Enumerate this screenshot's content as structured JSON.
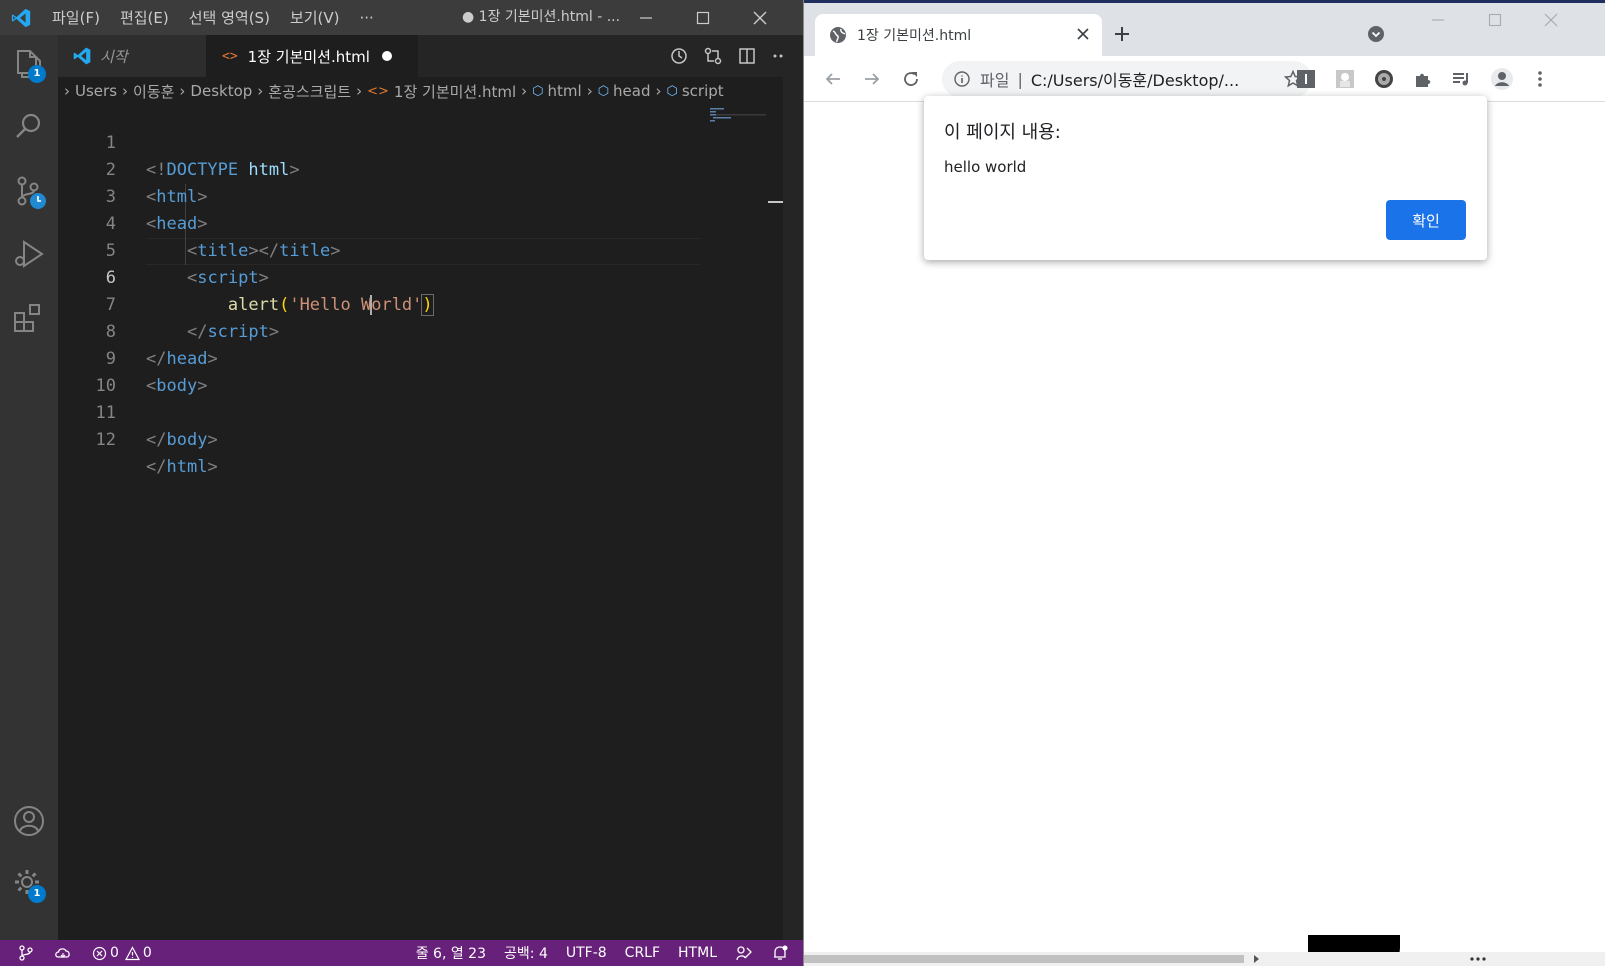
{
  "vscode": {
    "menu": [
      "파일(F)",
      "편집(E)",
      "선택 영역(S)",
      "보기(V)",
      "···"
    ],
    "title": "● 1장 기본미션.html - ...",
    "activity_badges": {
      "explorer": "1",
      "settings": "1"
    },
    "tabs": [
      {
        "label": "시작",
        "active": false
      },
      {
        "label": "1장 기본미션.html",
        "active": true,
        "dirty": true
      }
    ],
    "breadcrumb": [
      "Users",
      "이동훈",
      "Desktop",
      "혼공스크립트",
      "1장 기본미션.html",
      "html",
      "head",
      "script"
    ],
    "line_numbers": [
      "1",
      "2",
      "3",
      "4",
      "5",
      "6",
      "7",
      "8",
      "9",
      "10",
      "11",
      "12"
    ],
    "current_line": 6,
    "code": {
      "l1": {
        "open": "<!",
        "kw": "DOCTYPE",
        "attr": "html",
        "close": ">"
      },
      "l2": {
        "tag": "html"
      },
      "l3": {
        "tag": "head"
      },
      "l4": {
        "tag": "title",
        "close_tag": "title"
      },
      "l5": {
        "tag": "script"
      },
      "l6": {
        "fn": "alert",
        "str_before_cursor": "'Hello W",
        "str_after_cursor": "orld'"
      },
      "l7": {
        "tag": "script"
      },
      "l8": {
        "tag": "head"
      },
      "l9": {
        "tag": "body"
      },
      "l11": {
        "tag": "body"
      },
      "l12": {
        "tag": "html"
      }
    },
    "statusbar": {
      "errors": "0",
      "warnings": "0",
      "position": "줄 6, 열 23",
      "spaces": "공백: 4",
      "encoding": "UTF-8",
      "eol": "CRLF",
      "language": "HTML"
    },
    "colors": {
      "statusbar": "#68217a",
      "titlebar": "#3c3c3c",
      "editor_bg": "#1e1e1e"
    }
  },
  "chrome": {
    "tab_title": "1장 기본미션.html",
    "omnibox_prefix": "파일",
    "url": "C:/Users/이동훈/Desktop/...",
    "dialog": {
      "title": "이 페이지 내용:",
      "message": "hello world",
      "ok_label": "확인"
    },
    "colors": {
      "ok_button": "#1a73e8",
      "tabstrip": "#dee1e6"
    }
  }
}
